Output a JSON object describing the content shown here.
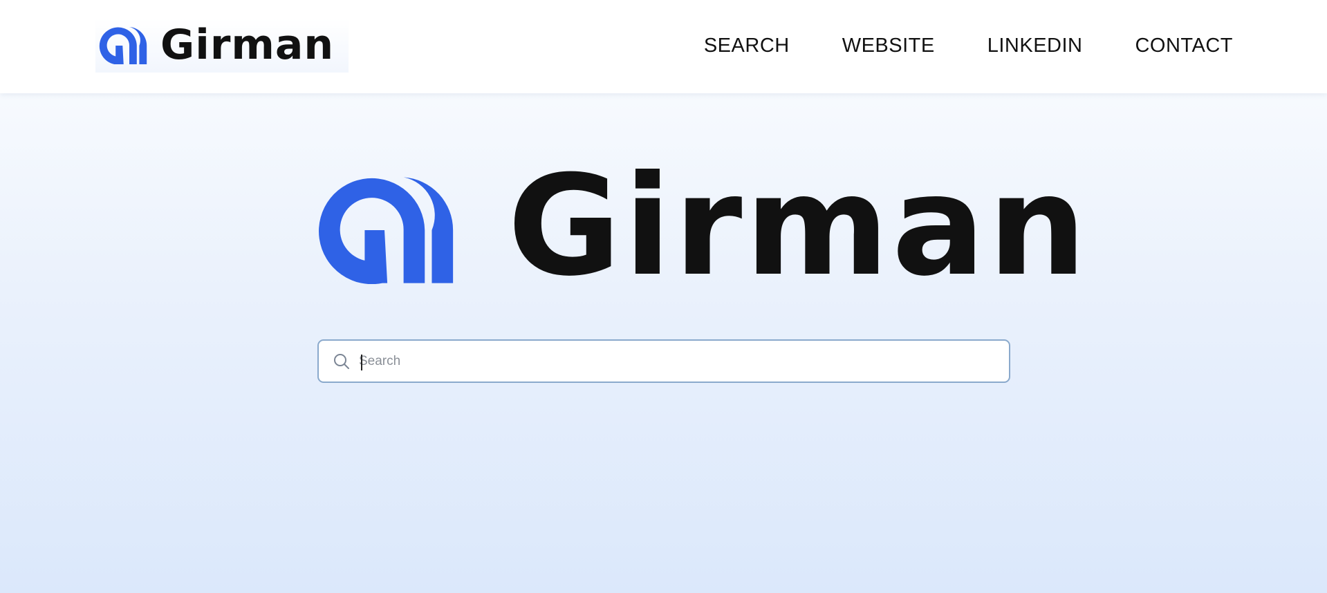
{
  "brand": {
    "name": "Girman",
    "logo_icon": "girman-mark-icon",
    "accent_color": "#2f62e6"
  },
  "nav": {
    "links": [
      {
        "label": "SEARCH"
      },
      {
        "label": "WEBSITE"
      },
      {
        "label": "LINKEDIN"
      },
      {
        "label": "CONTACT"
      }
    ]
  },
  "search": {
    "placeholder": "Search",
    "value": "",
    "icon": "search-icon"
  }
}
